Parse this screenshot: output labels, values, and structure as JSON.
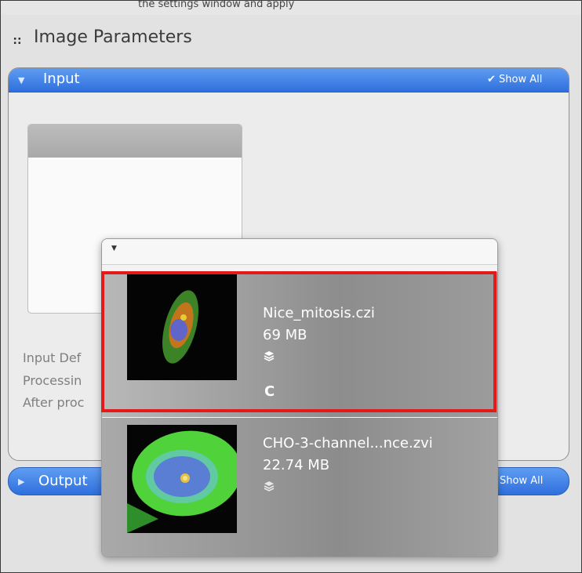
{
  "header": {
    "top_fragment": "the settings window and apply",
    "title": "Image Parameters"
  },
  "input_panel": {
    "label": "Input",
    "show_all": "Show All",
    "labels": [
      "Input Def",
      "Processin",
      "After proc"
    ]
  },
  "output_panel": {
    "label": "Output",
    "show_all": "Show All"
  },
  "dropdown": {
    "items": [
      {
        "name": "Nice_mitosis.czi",
        "size": "69 MB",
        "channel": "C"
      },
      {
        "name": "CHO-3-channel...nce.zvi",
        "size": "22.74 MB"
      }
    ]
  }
}
